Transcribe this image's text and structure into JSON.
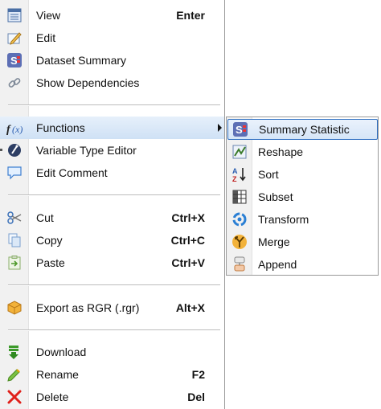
{
  "menu": {
    "items": [
      {
        "label": "View",
        "shortcut": "Enter",
        "icon": "view-icon"
      },
      {
        "label": "Edit",
        "shortcut": "",
        "icon": "edit-icon"
      },
      {
        "label": "Dataset Summary",
        "shortcut": "",
        "icon": "dataset-summary-icon"
      },
      {
        "label": "Show Dependencies",
        "shortcut": "",
        "icon": "link-icon"
      },
      {
        "label": "Functions",
        "shortcut": "",
        "icon": "functions-icon"
      },
      {
        "label": "Variable Type Editor",
        "shortcut": "",
        "icon": "variable-type-icon"
      },
      {
        "label": "Edit Comment",
        "shortcut": "",
        "icon": "comment-icon"
      },
      {
        "label": "Cut",
        "shortcut": "Ctrl+X",
        "icon": "scissors-icon"
      },
      {
        "label": "Copy",
        "shortcut": "Ctrl+C",
        "icon": "copy-icon"
      },
      {
        "label": "Paste",
        "shortcut": "Ctrl+V",
        "icon": "paste-icon"
      },
      {
        "label": "Export as RGR (.rgr)",
        "shortcut": "Alt+X",
        "icon": "export-icon"
      },
      {
        "label": "Download",
        "shortcut": "",
        "icon": "download-icon"
      },
      {
        "label": "Rename",
        "shortcut": "F2",
        "icon": "rename-icon"
      },
      {
        "label": "Delete",
        "shortcut": "Del",
        "icon": "delete-icon"
      }
    ]
  },
  "submenu": {
    "items": [
      {
        "label": "Summary Statistic",
        "icon": "summary-statistic-icon"
      },
      {
        "label": "Reshape",
        "icon": "reshape-icon"
      },
      {
        "label": "Sort",
        "icon": "sort-icon"
      },
      {
        "label": "Subset",
        "icon": "subset-icon"
      },
      {
        "label": "Transform",
        "icon": "transform-icon"
      },
      {
        "label": "Merge",
        "icon": "merge-icon"
      },
      {
        "label": "Append",
        "icon": "append-icon"
      }
    ]
  },
  "colors": {
    "highlight": "#cfe1f5",
    "highlight_border": "#2f6fc1",
    "gutter": "#f1f1f1"
  }
}
